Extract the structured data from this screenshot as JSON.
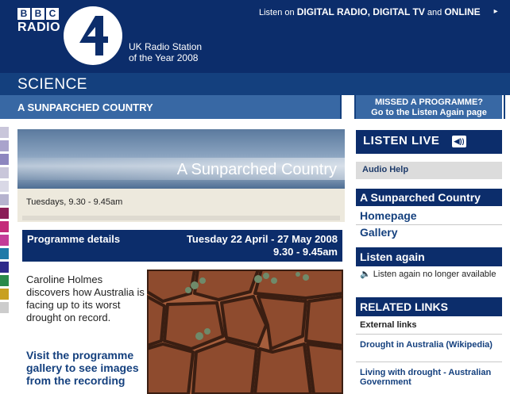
{
  "header": {
    "bbc_letters": [
      "B",
      "B",
      "C"
    ],
    "station": "RADIO",
    "award_line1": "UK Radio Station",
    "award_line2": "of the Year 2008",
    "listen_on_prefix": "Listen on",
    "listen_on_platforms": "DIGITAL RADIO, DIGITAL TV",
    "listen_on_and": "and",
    "listen_on_online": "ONLINE",
    "arrow": "▸"
  },
  "section": {
    "name": "SCIENCE",
    "programme_title": "A SUNPARCHED COUNTRY",
    "missed_line1": "MISSED A PROGRAMME?",
    "missed_line2": "Go to the Listen Again page"
  },
  "main": {
    "banner_title": "A Sunparched Country",
    "times": "Tuesdays, 9.30 - 9.45am",
    "details_label": "Programme details",
    "details_dates": "Tuesday 22 April - 27 May 2008",
    "details_time": "9.30 - 9.45am",
    "description": "Caroline Holmes discovers how Australia is facing up to its worst drought on record.",
    "visit_text": "Visit the programme gallery to see images from the recording"
  },
  "sidebar": {
    "listen_live": "LISTEN LIVE",
    "speaker_icon": "speaker-icon",
    "audio_help": "Audio Help",
    "programme_title": "A Sunparched Country",
    "links": [
      "Homepage",
      "Gallery"
    ],
    "listen_again_title": "Listen again",
    "listen_again_note": "Listen again no longer available",
    "related_title": "RELATED LINKS",
    "external_label": "External links",
    "related_links": [
      "Drought in Australia (Wikipedia)",
      "Living with drought - Australian Government"
    ]
  },
  "colors": {
    "navy": "#0c2d6b",
    "mid_blue": "#3868a4",
    "link_blue": "#14407e",
    "strip": [
      "#c9c6da",
      "#a9a3cc",
      "#8d86bf",
      "#c9c6da",
      "#d9d8e6",
      "#b6b3cf",
      "#8b1e57",
      "#c42b7a",
      "#c43d98",
      "#1e7aa8",
      "#2f2a8a",
      "#2a8a4a",
      "#c8a020",
      "#cccccc"
    ]
  }
}
